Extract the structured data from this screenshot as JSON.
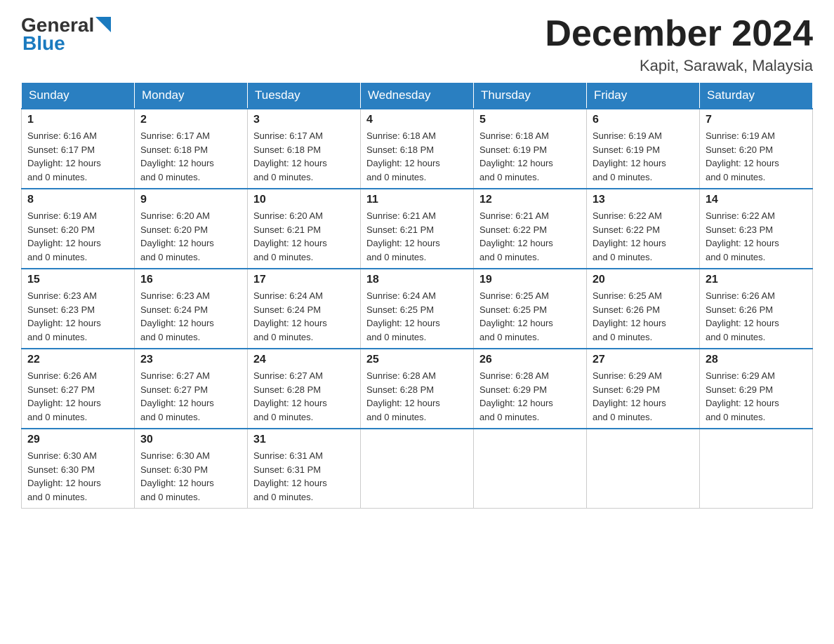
{
  "header": {
    "logo_general": "General",
    "logo_blue": "Blue",
    "month_title": "December 2024",
    "location": "Kapit, Sarawak, Malaysia"
  },
  "days_of_week": [
    "Sunday",
    "Monday",
    "Tuesday",
    "Wednesday",
    "Thursday",
    "Friday",
    "Saturday"
  ],
  "weeks": [
    [
      {
        "day": "1",
        "sunrise": "6:16 AM",
        "sunset": "6:17 PM",
        "daylight": "12 hours and 0 minutes."
      },
      {
        "day": "2",
        "sunrise": "6:17 AM",
        "sunset": "6:18 PM",
        "daylight": "12 hours and 0 minutes."
      },
      {
        "day": "3",
        "sunrise": "6:17 AM",
        "sunset": "6:18 PM",
        "daylight": "12 hours and 0 minutes."
      },
      {
        "day": "4",
        "sunrise": "6:18 AM",
        "sunset": "6:18 PM",
        "daylight": "12 hours and 0 minutes."
      },
      {
        "day": "5",
        "sunrise": "6:18 AM",
        "sunset": "6:19 PM",
        "daylight": "12 hours and 0 minutes."
      },
      {
        "day": "6",
        "sunrise": "6:19 AM",
        "sunset": "6:19 PM",
        "daylight": "12 hours and 0 minutes."
      },
      {
        "day": "7",
        "sunrise": "6:19 AM",
        "sunset": "6:20 PM",
        "daylight": "12 hours and 0 minutes."
      }
    ],
    [
      {
        "day": "8",
        "sunrise": "6:19 AM",
        "sunset": "6:20 PM",
        "daylight": "12 hours and 0 minutes."
      },
      {
        "day": "9",
        "sunrise": "6:20 AM",
        "sunset": "6:20 PM",
        "daylight": "12 hours and 0 minutes."
      },
      {
        "day": "10",
        "sunrise": "6:20 AM",
        "sunset": "6:21 PM",
        "daylight": "12 hours and 0 minutes."
      },
      {
        "day": "11",
        "sunrise": "6:21 AM",
        "sunset": "6:21 PM",
        "daylight": "12 hours and 0 minutes."
      },
      {
        "day": "12",
        "sunrise": "6:21 AM",
        "sunset": "6:22 PM",
        "daylight": "12 hours and 0 minutes."
      },
      {
        "day": "13",
        "sunrise": "6:22 AM",
        "sunset": "6:22 PM",
        "daylight": "12 hours and 0 minutes."
      },
      {
        "day": "14",
        "sunrise": "6:22 AM",
        "sunset": "6:23 PM",
        "daylight": "12 hours and 0 minutes."
      }
    ],
    [
      {
        "day": "15",
        "sunrise": "6:23 AM",
        "sunset": "6:23 PM",
        "daylight": "12 hours and 0 minutes."
      },
      {
        "day": "16",
        "sunrise": "6:23 AM",
        "sunset": "6:24 PM",
        "daylight": "12 hours and 0 minutes."
      },
      {
        "day": "17",
        "sunrise": "6:24 AM",
        "sunset": "6:24 PM",
        "daylight": "12 hours and 0 minutes."
      },
      {
        "day": "18",
        "sunrise": "6:24 AM",
        "sunset": "6:25 PM",
        "daylight": "12 hours and 0 minutes."
      },
      {
        "day": "19",
        "sunrise": "6:25 AM",
        "sunset": "6:25 PM",
        "daylight": "12 hours and 0 minutes."
      },
      {
        "day": "20",
        "sunrise": "6:25 AM",
        "sunset": "6:26 PM",
        "daylight": "12 hours and 0 minutes."
      },
      {
        "day": "21",
        "sunrise": "6:26 AM",
        "sunset": "6:26 PM",
        "daylight": "12 hours and 0 minutes."
      }
    ],
    [
      {
        "day": "22",
        "sunrise": "6:26 AM",
        "sunset": "6:27 PM",
        "daylight": "12 hours and 0 minutes."
      },
      {
        "day": "23",
        "sunrise": "6:27 AM",
        "sunset": "6:27 PM",
        "daylight": "12 hours and 0 minutes."
      },
      {
        "day": "24",
        "sunrise": "6:27 AM",
        "sunset": "6:28 PM",
        "daylight": "12 hours and 0 minutes."
      },
      {
        "day": "25",
        "sunrise": "6:28 AM",
        "sunset": "6:28 PM",
        "daylight": "12 hours and 0 minutes."
      },
      {
        "day": "26",
        "sunrise": "6:28 AM",
        "sunset": "6:29 PM",
        "daylight": "12 hours and 0 minutes."
      },
      {
        "day": "27",
        "sunrise": "6:29 AM",
        "sunset": "6:29 PM",
        "daylight": "12 hours and 0 minutes."
      },
      {
        "day": "28",
        "sunrise": "6:29 AM",
        "sunset": "6:29 PM",
        "daylight": "12 hours and 0 minutes."
      }
    ],
    [
      {
        "day": "29",
        "sunrise": "6:30 AM",
        "sunset": "6:30 PM",
        "daylight": "12 hours and 0 minutes."
      },
      {
        "day": "30",
        "sunrise": "6:30 AM",
        "sunset": "6:30 PM",
        "daylight": "12 hours and 0 minutes."
      },
      {
        "day": "31",
        "sunrise": "6:31 AM",
        "sunset": "6:31 PM",
        "daylight": "12 hours and 0 minutes."
      },
      null,
      null,
      null,
      null
    ]
  ]
}
